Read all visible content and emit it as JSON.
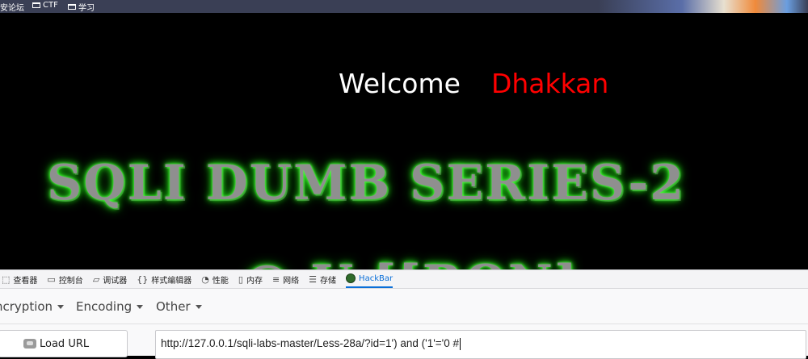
{
  "bookmarks": {
    "items": [
      {
        "label": "安论坛",
        "folder": false
      },
      {
        "label": "CTF",
        "folder": true
      },
      {
        "label": "学习",
        "folder": true
      }
    ]
  },
  "page": {
    "welcome": "Welcome",
    "name": "Dhakkan",
    "banner": "SQLI DUMB SERIES-2",
    "banner2": "@ U  [[RON]"
  },
  "devtools": {
    "tabs": [
      {
        "icon": "inspector-icon",
        "label": "查看器"
      },
      {
        "icon": "console-icon",
        "label": "控制台"
      },
      {
        "icon": "debugger-icon",
        "label": "调试器"
      },
      {
        "icon": "style-editor-icon",
        "label": "样式编辑器"
      },
      {
        "icon": "performance-icon",
        "label": "性能"
      },
      {
        "icon": "memory-icon",
        "label": "内存"
      },
      {
        "icon": "network-icon",
        "label": "网络"
      },
      {
        "icon": "storage-icon",
        "label": "存储"
      },
      {
        "icon": "hackbar-icon",
        "label": "HackBar"
      }
    ],
    "active_tab": "HackBar"
  },
  "hackbar": {
    "menu": {
      "encryption": "ncryption",
      "encoding": "Encoding",
      "other": "Other"
    },
    "load_url_label": "Load URL",
    "url": "http://127.0.0.1/sqli-labs-master/Less-28a/?id=1') and ('1'='0 #"
  },
  "colors": {
    "name_red": "#ff0000",
    "glow_green": "#2aff1d",
    "active_tab_blue": "#0a6fd8"
  }
}
